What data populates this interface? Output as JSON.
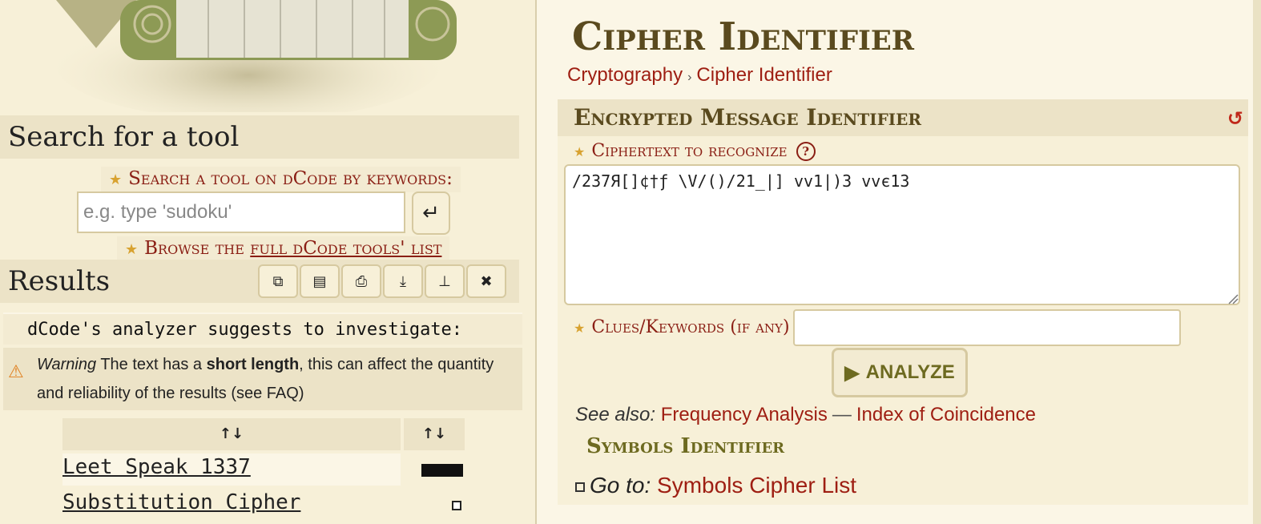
{
  "left": {
    "search_title": "Search for a tool",
    "keywords_label": "Search a tool on dCode by keywords:",
    "search_placeholder": "e.g. type 'sudoku'",
    "browse_prefix": "Browse the ",
    "browse_link": "full dCode tools' list",
    "results_title": "Results",
    "tool_icons": [
      "copy-icon",
      "share-icon",
      "print-icon",
      "download-icon",
      "pin-icon",
      "close-icon"
    ],
    "suggest_text": "dCode's analyzer suggests to investigate:",
    "warning_label": "Warning",
    "warning_text_a": " The text has a ",
    "warning_bold": "short length",
    "warning_text_b": ", this can affect the quantity and reliability of the results (see FAQ)",
    "sort_header_1": "↑↓",
    "sort_header_2": "↑↓",
    "rows": [
      {
        "name": "Leet Speak 1337",
        "score": 1.0
      },
      {
        "name": "Substitution Cipher",
        "score": 0.1
      }
    ]
  },
  "right": {
    "page_title": "Cipher Identifier",
    "breadcrumb_1": "Cryptography",
    "breadcrumb_sep": "›",
    "breadcrumb_2": "Cipher Identifier",
    "section_title": "Encrypted Message Identifier",
    "ciphertext_label": "Ciphertext to recognize",
    "help": "?",
    "ciphertext_value": "/237Я[]¢†ƒ \\V/()/21_|] vv1|)3 vvє13",
    "clues_label": "Clues/Keywords (if any)",
    "clues_value": "",
    "analyze_label": "ANALYZE",
    "see_also_label": "See also:",
    "see_also_1": "Frequency Analysis",
    "see_also_dash": "—",
    "see_also_2": "Index of Coincidence",
    "symbols_identifier": "Symbols Identifier",
    "goto_label": "Go to:",
    "goto_link": "Symbols Cipher List"
  }
}
